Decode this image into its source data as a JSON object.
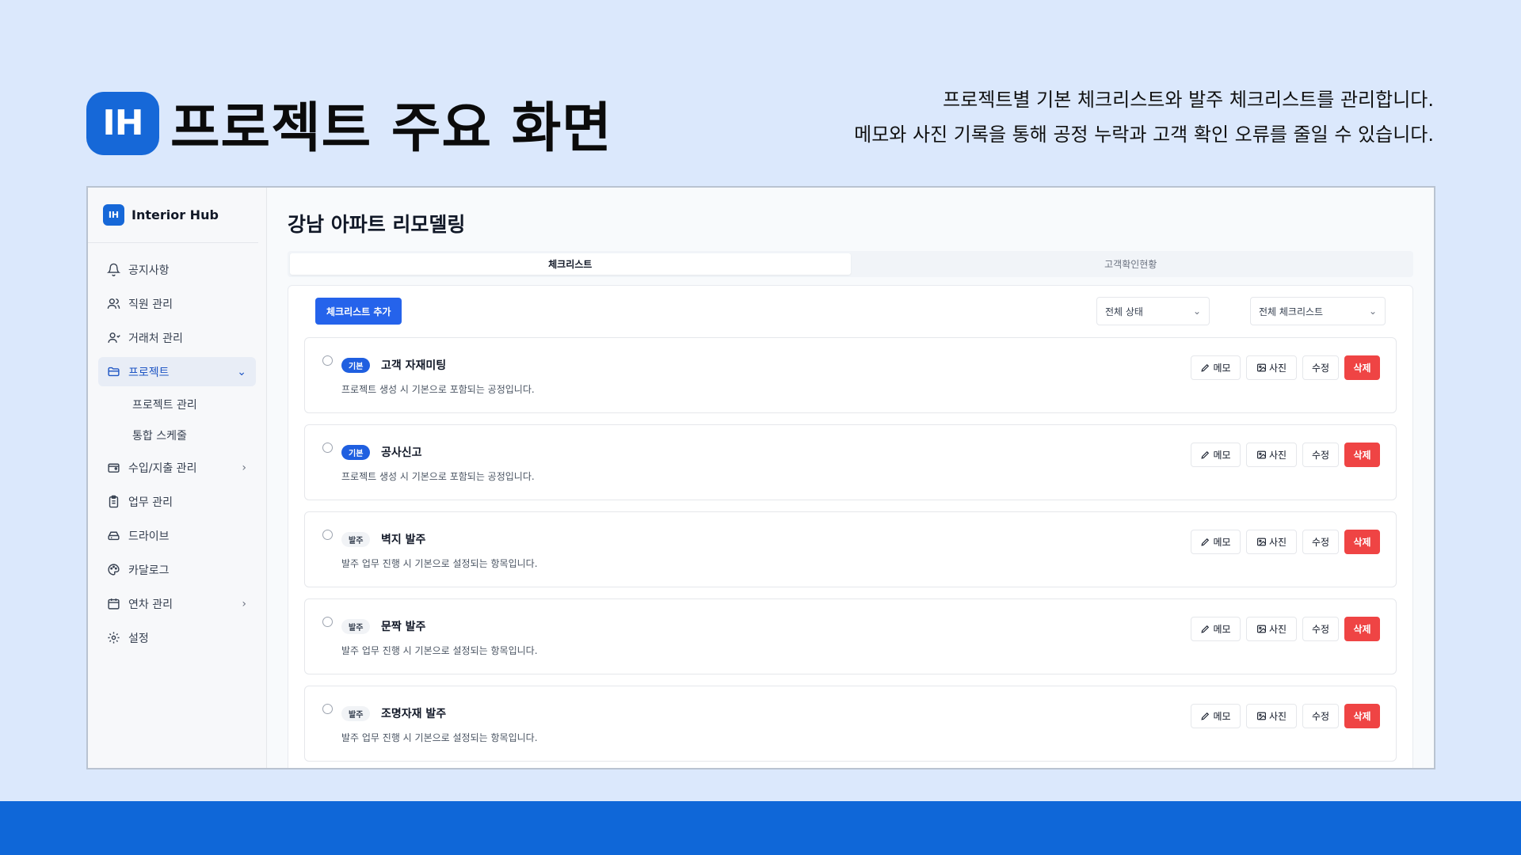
{
  "slide": {
    "logo_text": "IH",
    "title": "프로젝트 주요 화면",
    "description": [
      "프로젝트별 기본 체크리스트와 발주 체크리스트를 관리합니다.",
      "메모와 사진 기록을 통해 공정 누락과 고객 확인 오류를 줄일 수 있습니다."
    ]
  },
  "app": {
    "brand": {
      "logo_text": "IH",
      "name": "Interior Hub"
    },
    "sidebar": {
      "items": [
        {
          "label": "공지사항",
          "icon": "bell-icon"
        },
        {
          "label": "직원 관리",
          "icon": "users-icon"
        },
        {
          "label": "거래처 관리",
          "icon": "user-icon"
        },
        {
          "label": "프로젝트",
          "icon": "folder-icon",
          "active": true,
          "chevron": "⌄"
        },
        {
          "label": "프로젝트 관리",
          "sub": true
        },
        {
          "label": "통합 스케줄",
          "sub": true
        },
        {
          "label": "수입/지출 관리",
          "icon": "wallet-icon",
          "chevron": "›"
        },
        {
          "label": "업무 관리",
          "icon": "clipboard-icon"
        },
        {
          "label": "드라이브",
          "icon": "drive-icon"
        },
        {
          "label": "카달로그",
          "icon": "palette-icon"
        },
        {
          "label": "연차 관리",
          "icon": "calendar-icon",
          "chevron": "›"
        },
        {
          "label": "설정",
          "icon": "gear-icon"
        }
      ]
    },
    "project_title": "강남 아파트 리모델링",
    "tabs": [
      {
        "label": "체크리스트",
        "active": true
      },
      {
        "label": "고객확인현황",
        "active": false
      }
    ],
    "toolbar": {
      "add_label": "체크리스트 추가",
      "status_filter": "전체 상태",
      "checklist_filter": "전체 체크리스트"
    },
    "actions": {
      "memo": "메모",
      "photo": "사진",
      "edit": "수정",
      "delete": "삭제"
    },
    "checklist": [
      {
        "badge": "기본",
        "type": "basic",
        "title": "고객 자재미팅",
        "desc": "프로젝트 생성 시 기본으로 포함되는 공정입니다."
      },
      {
        "badge": "기본",
        "type": "basic",
        "title": "공사신고",
        "desc": "프로젝트 생성 시 기본으로 포함되는 공정입니다."
      },
      {
        "badge": "발주",
        "type": "order",
        "title": "벽지 발주",
        "desc": "발주 업무 진행 시 기본으로 설정되는 항목입니다."
      },
      {
        "badge": "발주",
        "type": "order",
        "title": "문짝 발주",
        "desc": "발주 업무 진행 시 기본으로 설정되는 항목입니다."
      },
      {
        "badge": "발주",
        "type": "order",
        "title": "조명자재 발주",
        "desc": "발주 업무 진행 시 기본으로 설정되는 항목입니다."
      }
    ]
  },
  "colors": {
    "accent": "#1668d8",
    "primary_button": "#2563eb",
    "danger": "#ef4444",
    "background": "#dbe8fc",
    "footer": "#0f67d8"
  }
}
